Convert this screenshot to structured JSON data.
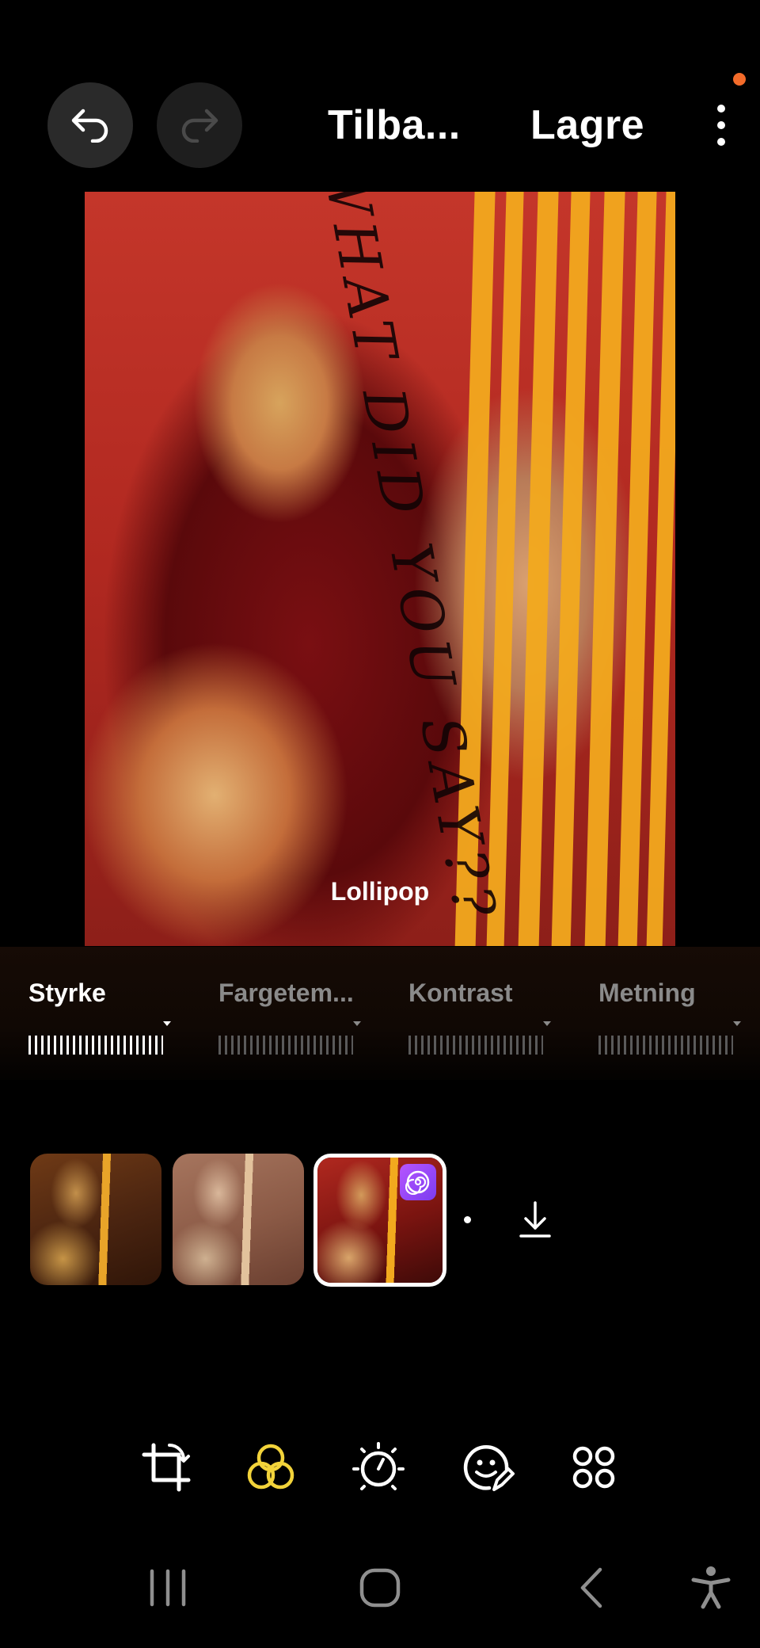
{
  "status": {
    "notification_dot_color": "#f36b2a"
  },
  "toolbar": {
    "undo_icon": "undo-arrow-icon",
    "redo_icon": "redo-arrow-icon",
    "revert_label": "Tilba...",
    "save_label": "Lagre",
    "more_icon": "more-vertical-icon"
  },
  "photo": {
    "painted_text": "WHAT DID YOU SAY??",
    "filter_name": "Lollipop"
  },
  "adjustments": [
    {
      "label": "Styrke",
      "active": true
    },
    {
      "label": "Fargetem...",
      "active": false
    },
    {
      "label": "Kontrast",
      "active": false
    },
    {
      "label": "Metning",
      "active": false
    }
  ],
  "filter_thumbnails": [
    {
      "name": "filter-preset-1",
      "selected": false
    },
    {
      "name": "filter-preset-2",
      "selected": false
    },
    {
      "name": "filter-preset-lollipop",
      "selected": true,
      "badge_icon": "spiral-lollipop-icon"
    }
  ],
  "download_icon": "download-icon",
  "bottom_tools": [
    {
      "icon": "crop-rotate-icon"
    },
    {
      "icon": "filters-icon",
      "active": true,
      "color": "#f2d33a"
    },
    {
      "icon": "brightness-adjust-icon"
    },
    {
      "icon": "sticker-emoji-icon"
    },
    {
      "icon": "more-tools-grid-icon"
    }
  ],
  "navigation": {
    "recent_apps_icon": "recent-apps-icon",
    "home_icon": "home-icon",
    "back_icon": "back-icon",
    "accessibility_icon": "accessibility-icon"
  }
}
